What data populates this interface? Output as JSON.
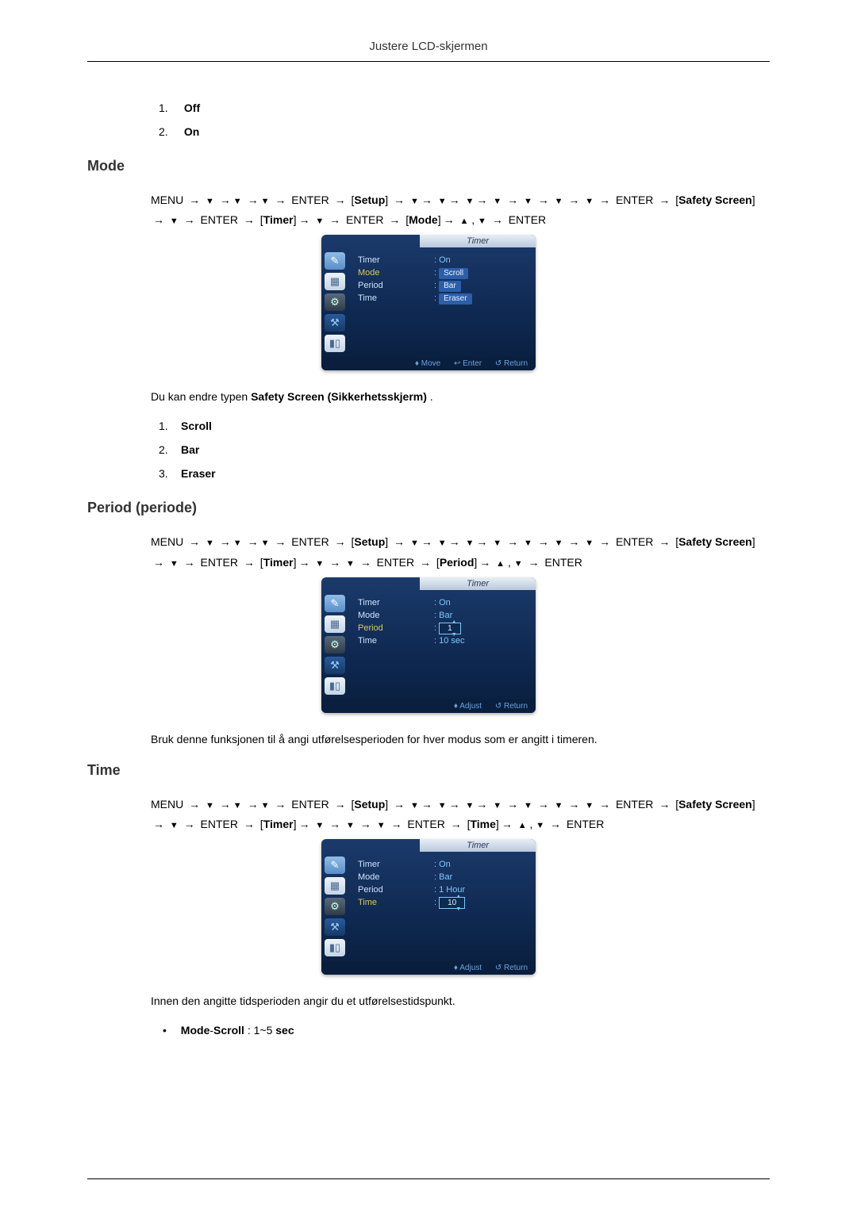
{
  "header": {
    "title": "Justere LCD-skjermen"
  },
  "list_off_on": [
    {
      "num": "1.",
      "label": "Off"
    },
    {
      "num": "2.",
      "label": "On"
    }
  ],
  "sections": {
    "mode": {
      "heading": "Mode",
      "nav": "MENU → ▼ →▼ →▼ → ENTER → [Setup] → ▼→ ▼→ ▼→ ▼ → ▼ → ▼ → ▼ → ENTER → [Safety Screen] → ▼ → ENTER → [Timer]→ ▼ → ENTER → [Mode]→ ▲ , ▼ → ENTER",
      "osd": {
        "title": "Timer",
        "rows": [
          {
            "label": "Timer",
            "value": ": On"
          },
          {
            "label": "Mode",
            "value": ""
          },
          {
            "label": "Period",
            "value": ""
          },
          {
            "label": "Time",
            "value": ""
          }
        ],
        "dropdown": [
          "Scroll",
          "Bar",
          "Eraser"
        ],
        "foot": [
          "♦ Move",
          "↩ Enter",
          "↺ Return"
        ],
        "highlight_label": "Mode"
      },
      "desc_prefix": "Du kan endre typen ",
      "desc_bold": "Safety Screen (Sikkerhetsskjerm)",
      "desc_suffix": " .",
      "options": [
        {
          "num": "1.",
          "label": "Scroll"
        },
        {
          "num": "2.",
          "label": "Bar"
        },
        {
          "num": "3.",
          "label": "Eraser"
        }
      ]
    },
    "period": {
      "heading": "Period (periode)",
      "nav": "MENU → ▼ →▼ →▼ → ENTER → [Setup] → ▼→ ▼→ ▼→ ▼ → ▼ → ▼ → ▼ → ENTER → [Safety Screen] → ▼ → ENTER → [Timer]→ ▼ → ▼ → ENTER → [Period]→ ▲ , ▼ → ENTER",
      "osd": {
        "title": "Timer",
        "rows": [
          {
            "label": "Timer",
            "value": ": On"
          },
          {
            "label": "Mode",
            "value": ": Bar"
          },
          {
            "label": "Period",
            "value": ""
          },
          {
            "label": "Time",
            "value": ": 10 sec"
          }
        ],
        "editbox": "1",
        "edit_row": "Period",
        "foot": [
          "♦ Adjust",
          "↺ Return"
        ],
        "highlight_label": "Period"
      },
      "desc": "Bruk denne funksjonen til å angi utførelsesperioden for hver modus som er angitt i timeren."
    },
    "time": {
      "heading": "Time",
      "nav": "MENU → ▼ →▼ →▼ → ENTER → [Setup] → ▼→ ▼→ ▼→ ▼ → ▼ → ▼ → ▼ → ENTER → [Safety Screen] → ▼ → ENTER → [Timer]→ ▼ → ▼ → ▼ → ENTER → [Time]→ ▲ , ▼ → ENTER",
      "osd": {
        "title": "Timer",
        "rows": [
          {
            "label": "Timer",
            "value": ": On"
          },
          {
            "label": "Mode",
            "value": ": Bar"
          },
          {
            "label": "Period",
            "value": ": 1 Hour"
          },
          {
            "label": "Time",
            "value": ""
          }
        ],
        "editbox": "10",
        "edit_row": "Time",
        "foot": [
          "♦ Adjust",
          "↺ Return"
        ],
        "highlight_label": "Time"
      },
      "desc": "Innen den angitte tidsperioden angir du et utførelsestidspunkt.",
      "bullets": [
        {
          "bold": "Mode",
          "plain1": "-",
          "bold2": "Scroll",
          "plain2": " : 1~5 ",
          "bold3": "sec"
        }
      ]
    }
  }
}
